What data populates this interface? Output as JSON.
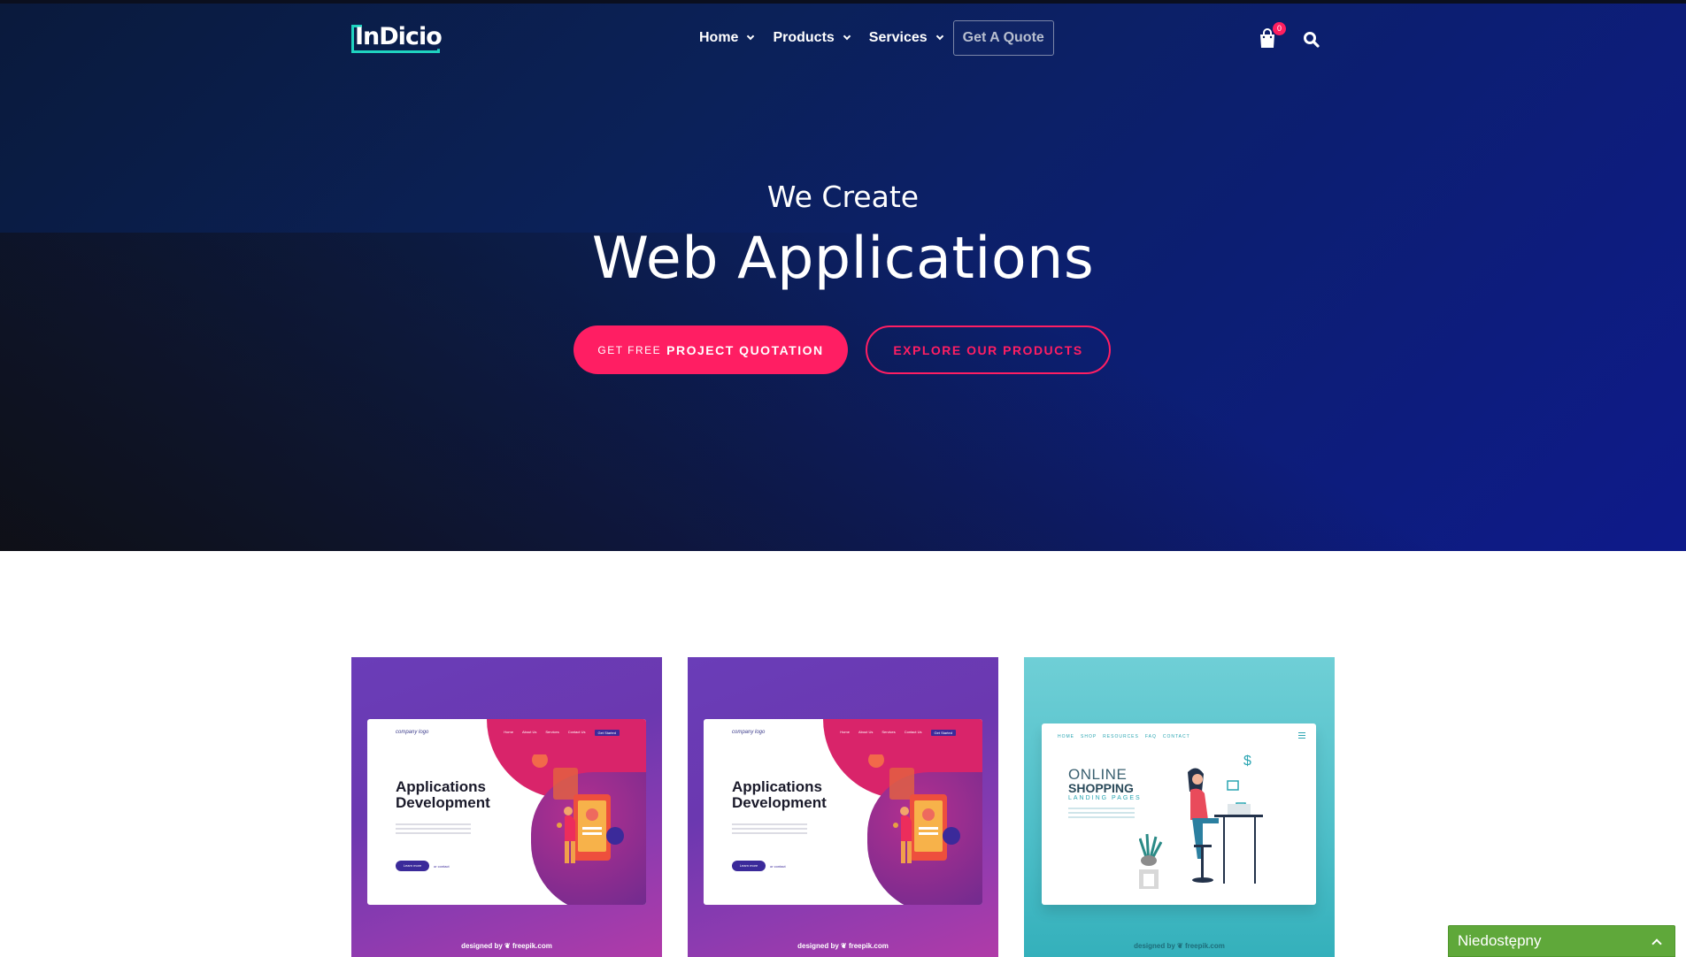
{
  "header": {
    "logo_text": "InDicio",
    "nav": [
      {
        "label": "Home"
      },
      {
        "label": "Products"
      },
      {
        "label": "Services"
      }
    ],
    "quote_button": "Get A Quote",
    "cart_count": "0",
    "icons": {
      "cart": "shopping-bag-icon",
      "search": "search-icon"
    }
  },
  "hero": {
    "subtitle": "We Create",
    "title": "Web Applications",
    "primary_button": {
      "prefix": "GET FREE",
      "main": "PROJECT QUOTATION"
    },
    "outline_button": "EXPLORE OUR PRODUCTS"
  },
  "cards": [
    {
      "mock_logo": "company logo",
      "mock_nav": [
        "Home",
        "About Us",
        "Services",
        "Contact Us"
      ],
      "mock_nav_button": "Get Started",
      "mock_title_1": "Applications",
      "mock_title_2": "Development",
      "mock_button": "Learn more",
      "mock_link": "or contact",
      "credit": "designed by ❦ freepik.com"
    },
    {
      "mock_logo": "company logo",
      "mock_nav": [
        "Home",
        "About Us",
        "Services",
        "Contact Us"
      ],
      "mock_nav_button": "Get Started",
      "mock_title_1": "Applications",
      "mock_title_2": "Development",
      "mock_button": "Learn more",
      "mock_link": "or contact",
      "credit": "designed by ❦ freepik.com"
    },
    {
      "shop_nav": [
        "HOME",
        "SHOP",
        "RESOURCES",
        "FAQ",
        "CONTACT"
      ],
      "title_1": "ONLINE",
      "title_2": "SHOPPING",
      "title_3": "LANDING PAGES",
      "credit": "designed by ❦ freepik.com"
    }
  ],
  "status_widget": {
    "label": "Niedostępny"
  },
  "colors": {
    "accent": "#ff1e63",
    "hero_bg": "#0b2158",
    "logo_accent": "#1fd3c0",
    "status_green": "#5fa83a"
  }
}
